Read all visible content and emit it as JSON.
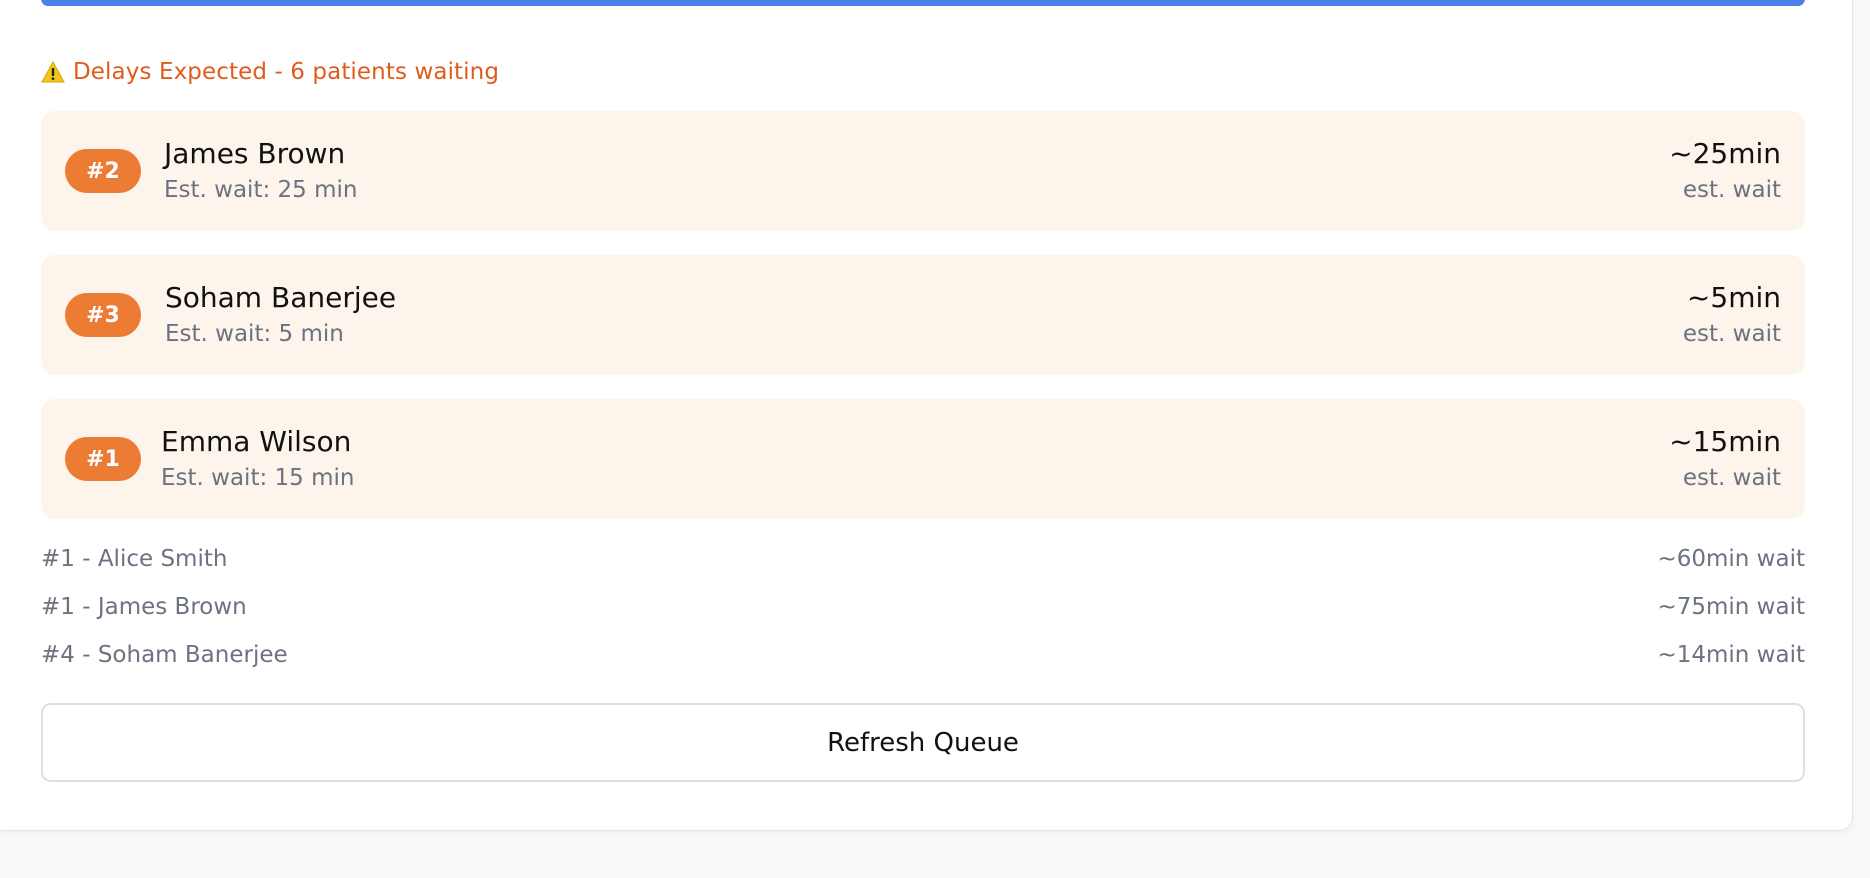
{
  "alert": {
    "icon": "warning-icon",
    "text": "Delays Expected - 6 patients waiting",
    "color": "#e05c1c"
  },
  "colors": {
    "accent": "#4a80e8",
    "badge": "#ec7b33",
    "card_bg": "#fdf5ec"
  },
  "queue": [
    {
      "badge": "#2",
      "name": "James Brown",
      "subtitle": "Est. wait: 25 min",
      "wait": "~25min",
      "wait_label": "est. wait"
    },
    {
      "badge": "#3",
      "name": "Soham Banerjee",
      "subtitle": "Est. wait: 5 min",
      "wait": "~5min",
      "wait_label": "est. wait"
    },
    {
      "badge": "#1",
      "name": "Emma Wilson",
      "subtitle": "Est. wait: 15 min",
      "wait": "~15min",
      "wait_label": "est. wait"
    }
  ],
  "history": [
    {
      "label": "#1 - Alice Smith",
      "wait": "~60min wait"
    },
    {
      "label": "#1 - James Brown",
      "wait": "~75min wait"
    },
    {
      "label": "#4 - Soham Banerjee",
      "wait": "~14min wait"
    }
  ],
  "refresh_label": "Refresh Queue"
}
